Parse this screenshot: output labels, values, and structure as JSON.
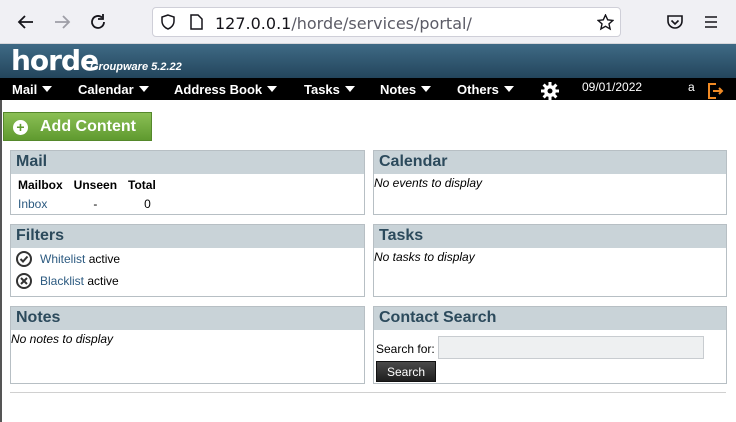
{
  "browser": {
    "url_host": "127.0.0.1",
    "url_path": "/horde/services/portal/"
  },
  "header": {
    "logo": "horde",
    "subtitle": "Groupware 5.2.22"
  },
  "menu": {
    "items": [
      {
        "label": "Mail"
      },
      {
        "label": "Calendar"
      },
      {
        "label": "Address Book"
      },
      {
        "label": "Tasks"
      },
      {
        "label": "Notes"
      },
      {
        "label": "Others"
      }
    ],
    "date": "09/01/2022",
    "user": "a"
  },
  "add_content": {
    "label": "Add Content"
  },
  "blocks": {
    "mail": {
      "title": "Mail",
      "columns": [
        "Mailbox",
        "Unseen",
        "Total"
      ],
      "rows": [
        {
          "mailbox": "Inbox",
          "unseen": "-",
          "total": "0"
        }
      ]
    },
    "calendar": {
      "title": "Calendar",
      "message": "No events to display"
    },
    "filters": {
      "title": "Filters",
      "items": [
        {
          "name": "Whitelist",
          "status": "active"
        },
        {
          "name": "Blacklist",
          "status": "active"
        }
      ]
    },
    "tasks": {
      "title": "Tasks",
      "message": "No tasks to display"
    },
    "notes": {
      "title": "Notes",
      "message": "No notes to display"
    },
    "contact_search": {
      "title": "Contact Search",
      "search_label": "Search for:",
      "search_value": "",
      "button": "Search"
    }
  },
  "colors": {
    "header_top": "#3f6a85",
    "menubar": "#000000",
    "block_header": "#c9d3d8",
    "add_content": "#6fa83c",
    "link": "#2c5a80"
  }
}
